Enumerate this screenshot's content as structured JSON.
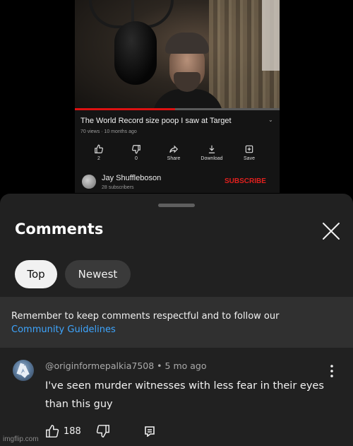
{
  "video": {
    "title": "The World Record size poop I saw at Target",
    "meta": "70 views · 10 months ago",
    "progress": 0.49,
    "actions": [
      {
        "icon": "thumbs-up-icon",
        "label": "2"
      },
      {
        "icon": "thumbs-down-icon",
        "label": "0"
      },
      {
        "icon": "share-icon",
        "label": "Share"
      },
      {
        "icon": "download-icon",
        "label": "Download"
      },
      {
        "icon": "save-icon",
        "label": "Save"
      }
    ],
    "channel": {
      "name": "Jay Shuffleboson",
      "subscribers": "28 subscribers",
      "subscribe_label": "SUBSCRIBE"
    },
    "colors": {
      "subscribe": "#e0201e",
      "progress": "#dd1111"
    }
  },
  "comments_panel": {
    "title": "Comments",
    "close_icon": "close-icon",
    "chips": [
      {
        "label": "Top",
        "selected": true
      },
      {
        "label": "Newest",
        "selected": false
      }
    ],
    "notice": {
      "text": "Remember to keep comments respectful and to follow our",
      "link": "Community Guidelines"
    },
    "comment": {
      "author": "@originformepalkia7508",
      "age": "5 mo ago",
      "text": "I've seen murder witnesses with less fear in their eyes than this guy",
      "likes": "188",
      "icons": [
        "thumbs-up-icon",
        "thumbs-down-icon",
        "reply-icon",
        "more-vertical-icon"
      ]
    },
    "colors": {
      "background": "#212121",
      "link": "#3ea6ff",
      "notice_background": "#303030"
    }
  },
  "watermark": "imgflip.com"
}
